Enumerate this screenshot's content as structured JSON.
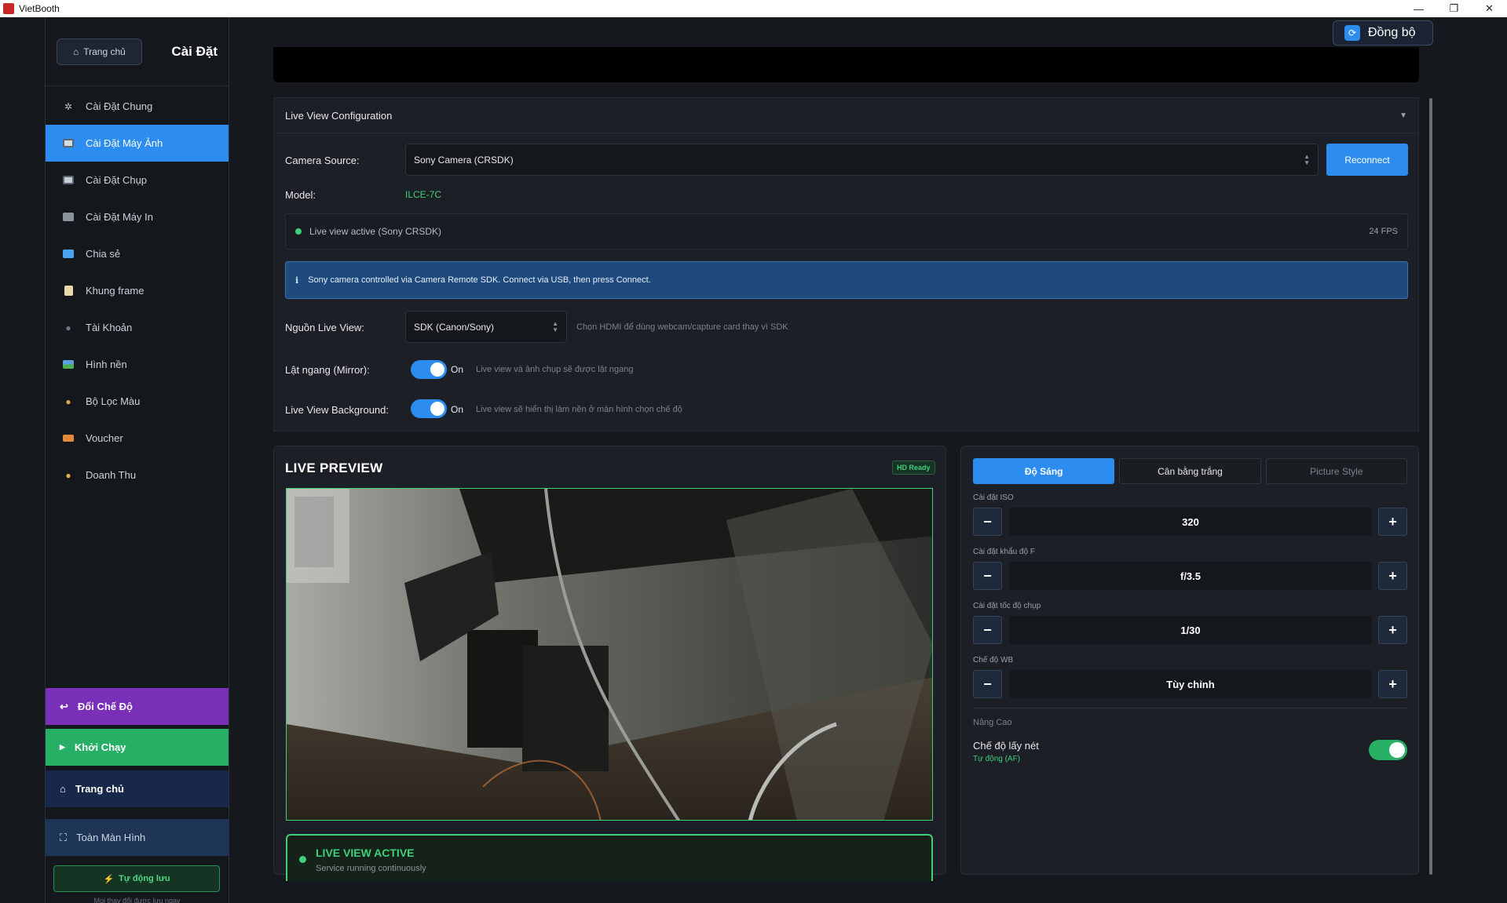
{
  "window": {
    "title": "VietBooth",
    "controls": [
      "—",
      "❐",
      "✕"
    ]
  },
  "sidebar": {
    "home_pill": "Trang chủ",
    "title": "Cài Đặt",
    "items": [
      {
        "label": "Cài Đặt Chung",
        "icon": "gear-icon"
      },
      {
        "label": "Cài Đặt Máy Ảnh",
        "icon": "camera-icon",
        "active": true
      },
      {
        "label": "Cài Đặt Chụp",
        "icon": "capture-icon"
      },
      {
        "label": "Cài Đặt Máy In",
        "icon": "printer-icon"
      },
      {
        "label": "Chia sẻ",
        "icon": "share-icon"
      },
      {
        "label": "Khung frame",
        "icon": "frame-icon"
      },
      {
        "label": "Tài Khoản",
        "icon": "user-icon"
      },
      {
        "label": "Hình nền",
        "icon": "image-icon"
      },
      {
        "label": "Bộ Lọc Màu",
        "icon": "palette-icon"
      },
      {
        "label": "Voucher",
        "icon": "ticket-icon"
      },
      {
        "label": "Doanh Thu",
        "icon": "moneybag-icon"
      }
    ],
    "buttons": {
      "mode": "Đổi Chế Độ",
      "run": "Khởi Chạy",
      "home": "Trang chủ",
      "fullscreen": "Toàn Màn Hình"
    },
    "autosave": "Tự động lưu",
    "autosave_note": "Mọi thay đổi được lưu ngay"
  },
  "sync_button": "Đồng bộ",
  "config": {
    "heading": "Live View Configuration",
    "camera_source_label": "Camera Source:",
    "camera_source_value": "Sony Camera (CRSDK)",
    "reconnect": "Reconnect",
    "model_label": "Model:",
    "model_value": "ILCE-7C",
    "status_text": "Live view active (Sony CRSDK)",
    "fps": "24 FPS",
    "info_text": "Sony camera controlled via Camera Remote SDK. Connect via USB, then press Connect.",
    "live_source_label": "Nguồn Live View:",
    "live_source_value": "SDK (Canon/Sony)",
    "live_source_hint": "Chọn HDMI để dùng webcam/capture card thay vì SDK",
    "mirror_label": "Lật ngang (Mirror):",
    "mirror_state": "On",
    "mirror_hint": "Live view và ảnh chụp sẽ được lật ngang",
    "bg_label": "Live View Background:",
    "bg_state": "On",
    "bg_hint": "Live view sẽ hiển thị làm nền ở màn hình chọn chế độ"
  },
  "preview": {
    "title": "LIVE PREVIEW",
    "badge": "HD Ready",
    "status_title": "LIVE VIEW ACTIVE",
    "status_sub": "Service running continuously"
  },
  "controls": {
    "tabs": [
      "Độ Sáng",
      "Cân bằng trắng",
      "Picture Style"
    ],
    "iso_label": "Cài đặt ISO",
    "iso_value": "320",
    "aperture_label": "Cài đặt khẩu độ F",
    "aperture_value": "f/3.5",
    "shutter_label": "Cài đặt tốc độ chụp",
    "shutter_value": "1/30",
    "wb_label": "Chế độ WB",
    "wb_value": "Tùy chỉnh",
    "minus": "−",
    "plus": "+",
    "advanced_label": "Nâng Cao",
    "af_label": "Chế độ lấy nét",
    "af_sub": "Tự động (AF)"
  },
  "colors": {
    "accent": "#2d8cf0",
    "success": "#3fd07a",
    "mode_button": "#7a2fb8",
    "run_button": "#27b065"
  }
}
